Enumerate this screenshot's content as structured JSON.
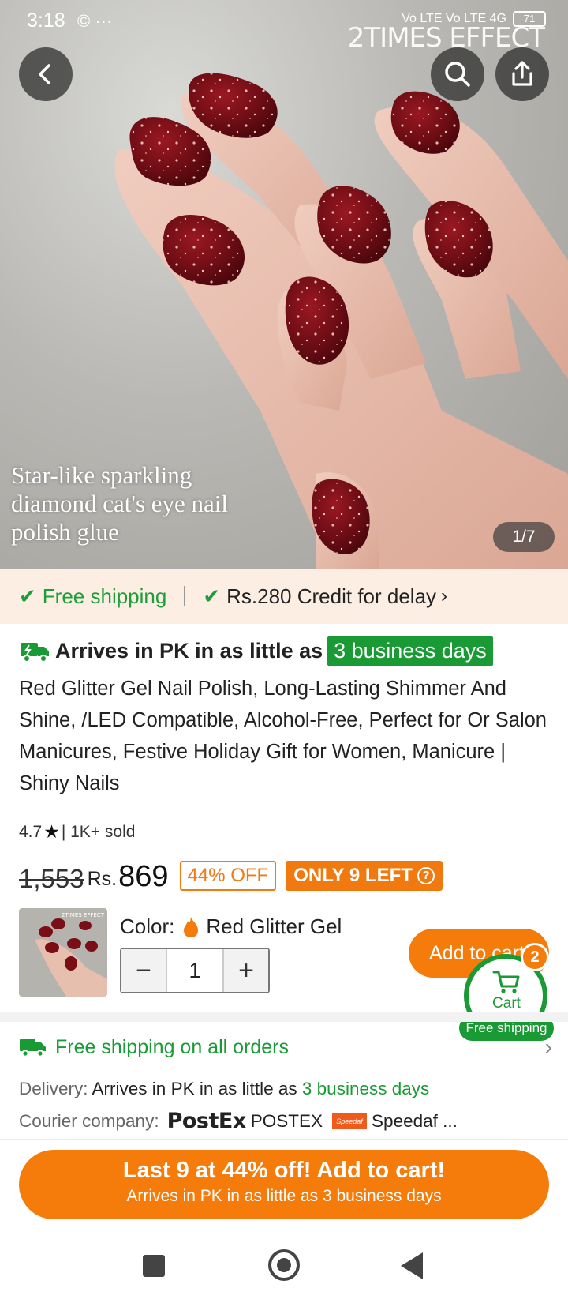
{
  "status_bar": {
    "time": "3:18",
    "icons": "© ···",
    "network": "Vo LTE  Vo LTE 4G",
    "battery": "71"
  },
  "hero": {
    "watermark": "2TIMES EFFECT",
    "caption": "Star-like sparkling diamond cat's eye nail polish glue",
    "counter": "1/7"
  },
  "promo": {
    "free_shipping": "Free shipping",
    "credit": "Rs.280 Credit for delay"
  },
  "delivery_banner": {
    "text": "Arrives in PK in as little as",
    "highlight": "3 business days"
  },
  "product": {
    "title": "Red Glitter Gel Nail Polish, Long-Lasting Shimmer And Shine, /LED Compatible, Alcohol-Free, Perfect for Or Salon Manicures, Festive Holiday Gift for Women, Manicure | Shiny Nails",
    "rating": "4.7",
    "sold": "| 1K+ sold",
    "old_price": "1,553",
    "currency": "Rs.",
    "price": "869",
    "discount": "44% OFF",
    "stock": "ONLY 9 LEFT"
  },
  "variant": {
    "label": "Color:",
    "value": "Red Glitter Gel",
    "quantity": "1",
    "thumb_watermark": "2TIMES EFFECT"
  },
  "add_to_cart": "Add to cart",
  "cart": {
    "label": "Cart",
    "count": "2",
    "badge": "Free shipping"
  },
  "shipping": {
    "headline": "Free shipping on all orders",
    "delivery_label": "Delivery:",
    "delivery_text": "Arrives in PK in as little as",
    "delivery_days": "3 business days",
    "courier_label": "Courier company:",
    "courier_logo": "PostEx",
    "courier_1": "POSTEX",
    "courier_logo_2": "Speedaf",
    "courier_2": "Speedaf ..."
  },
  "cta": {
    "line1": "Last 9 at 44% off! Add to cart!",
    "line2": "Arrives in PK in as little as 3 business days"
  },
  "colors": {
    "orange": "#f57b0a",
    "green": "#1a9a34",
    "promo_bg": "#fdeee4"
  }
}
